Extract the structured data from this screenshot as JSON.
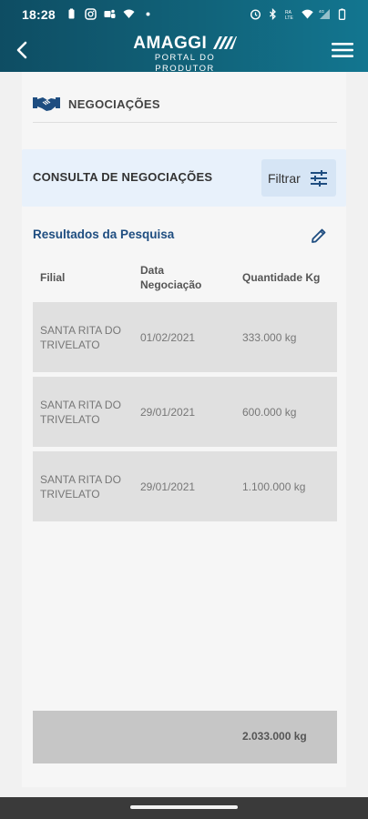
{
  "status_bar": {
    "time": "18:28",
    "left_icons": [
      "battery-saver-icon",
      "instagram-icon",
      "teams-icon",
      "signal-icon",
      "dot-icon"
    ],
    "right_icons": [
      "alarm-icon",
      "bluetooth-icon",
      "lte-icon",
      "wifi-icon",
      "signal-4g-icon",
      "battery-icon"
    ]
  },
  "app_bar": {
    "logo_title": "AMAGGI",
    "logo_subtitle": "PORTAL DO PRODUTOR",
    "back_icon": "back-arrow-icon",
    "menu_icon": "hamburger-menu-icon"
  },
  "section": {
    "icon": "handshake-icon",
    "title": "NEGOCIAÇÕES"
  },
  "search": {
    "title": "CONSULTA DE NEGOCIAÇÕES",
    "filter_label": "Filtrar",
    "filter_icon": "sliders-icon"
  },
  "results": {
    "title": "Resultados da Pesquisa",
    "edit_icon": "pencil-icon",
    "columns": {
      "filial": "Filial",
      "data_line1": "Data",
      "data_line2": "Negociação",
      "quantidade": "Quantidade Kg"
    },
    "rows": [
      {
        "filial_line1": "SANTA RITA DO",
        "filial_line2": "TRIVELATO",
        "data": "01/02/2021",
        "quantidade": "333.000 kg"
      },
      {
        "filial_line1": "SANTA RITA DO",
        "filial_line2": "TRIVELATO",
        "data": "29/01/2021",
        "quantidade": "600.000 kg"
      },
      {
        "filial_line1": "SANTA RITA DO",
        "filial_line2": "TRIVELATO",
        "data": "29/01/2021",
        "quantidade": "1.100.000 kg"
      }
    ],
    "total": "2.033.000 kg"
  },
  "colors": {
    "header_start": "#0e4d63",
    "header_end": "#127690",
    "accent_blue": "#1e4d80",
    "search_bg": "#e8f1fb",
    "filter_bg": "#d6e5f5"
  }
}
